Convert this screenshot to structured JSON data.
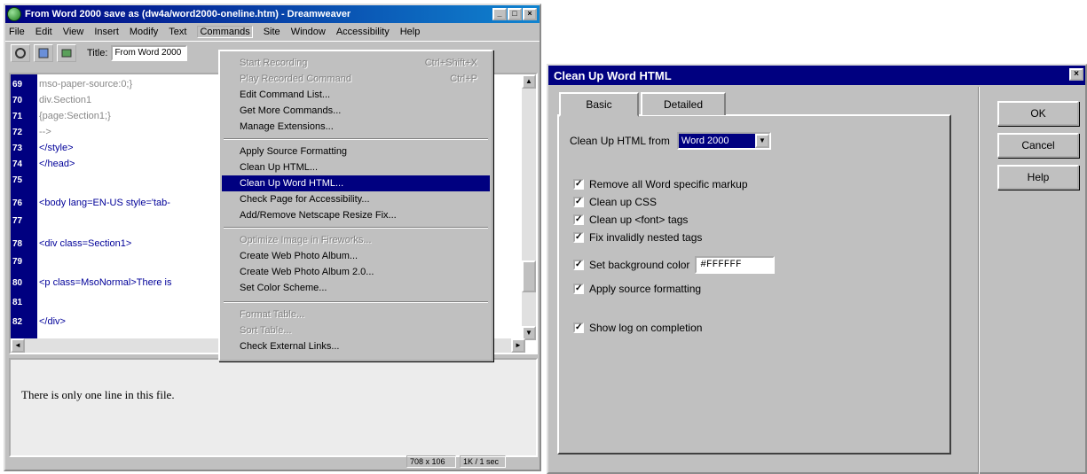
{
  "dreamweaver": {
    "window_title": "From Word 2000 save as (dw4a/word2000-oneline.htm) - Dreamweaver",
    "title_buttons": [
      "_",
      "□",
      "×"
    ],
    "menus": [
      "File",
      "Edit",
      "View",
      "Insert",
      "Modify",
      "Text",
      "Commands",
      "Site",
      "Window",
      "Accessibility",
      "Help"
    ],
    "toolbar": {
      "title_label": "Title:",
      "title_value": "From Word 2000"
    },
    "code_lines": [
      {
        "num": "69",
        "text": "mso-paper-source:0;}"
      },
      {
        "num": "70",
        "text": "div.Section1"
      },
      {
        "num": "71",
        "text": "{page:Section1;}"
      },
      {
        "num": "72",
        "text": "-->"
      },
      {
        "num": "73",
        "text": "</style>"
      },
      {
        "num": "74",
        "text": "</head>"
      },
      {
        "num": "75",
        "text": ""
      },
      {
        "num": "76",
        "text": "<body lang=EN-US style='tab-"
      },
      {
        "num": "77",
        "text": ""
      },
      {
        "num": "78",
        "text": "<div class=Section1>"
      },
      {
        "num": "79",
        "text": ""
      },
      {
        "num": "80",
        "text": "<p class=MsoNormal>There is"
      },
      {
        "num": "81",
        "text": ""
      },
      {
        "num": "82",
        "text": "</div>"
      }
    ],
    "design_text": "There is only one line in this file.",
    "status": [
      "708 x 106",
      "1K / 1 sec"
    ]
  },
  "commands_menu": {
    "items": [
      {
        "label": "Start Recording",
        "shortcut": "Ctrl+Shift+X",
        "disabled": true
      },
      {
        "label": "Play Recorded Command",
        "shortcut": "Ctrl+P",
        "disabled": true
      },
      {
        "label": "Edit Command List...",
        "disabled": false
      },
      {
        "label": "Get More Commands...",
        "disabled": false
      },
      {
        "label": "Manage Extensions...",
        "disabled": false
      },
      {
        "label": "Apply Source Formatting",
        "disabled": false
      },
      {
        "label": "Clean Up HTML...",
        "disabled": false
      },
      {
        "label": "Clean Up Word HTML...",
        "disabled": false,
        "selected": true
      },
      {
        "label": "Check Page for Accessibility...",
        "disabled": false
      },
      {
        "label": "Add/Remove Netscape Resize Fix...",
        "disabled": false
      },
      {
        "label": "Optimize Image in Fireworks...",
        "disabled": true
      },
      {
        "label": "Create Web Photo Album...",
        "disabled": false
      },
      {
        "label": "Create Web Photo Album 2.0...",
        "disabled": false
      },
      {
        "label": "Set Color Scheme...",
        "disabled": false
      },
      {
        "label": "Format Table...",
        "disabled": true
      },
      {
        "label": "Sort Table...",
        "disabled": true
      },
      {
        "label": "Check External Links...",
        "disabled": false
      }
    ]
  },
  "dialog": {
    "title": "Clean Up Word HTML",
    "close": "×",
    "tabs": [
      "Basic",
      "Detailed"
    ],
    "source_label": "Clean Up HTML from",
    "source_value": "Word 2000",
    "options": [
      "Remove all Word specific markup",
      "Clean up CSS",
      "Clean up <font> tags",
      "Fix invalidly nested tags",
      "Set background color",
      "Apply source formatting",
      "Show log on completion"
    ],
    "check_mark": "✓",
    "bg_color_value": "#FFFFFF",
    "buttons": {
      "ok": "OK",
      "cancel": "Cancel",
      "help": "Help"
    }
  }
}
